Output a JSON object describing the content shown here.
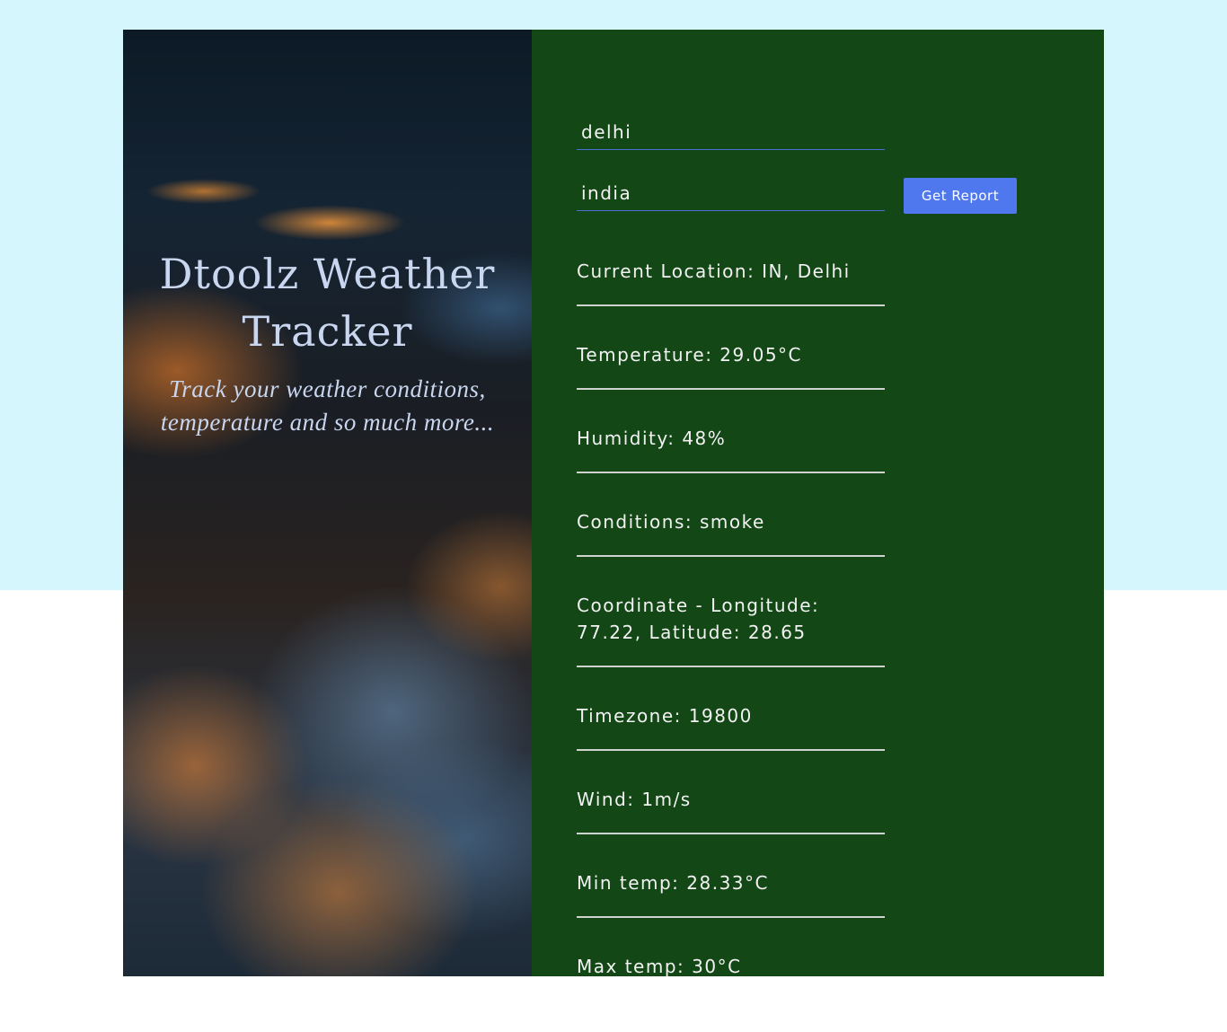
{
  "hero": {
    "title": "Dtoolz Weather Tracker",
    "subtitle": "Track your weather conditions, temperature and so much more..."
  },
  "form": {
    "city_value": "delhi",
    "country_value": "india",
    "button_label": "Get Report"
  },
  "report": {
    "location": "Current Location: IN, Delhi",
    "temperature": "Temperature: 29.05°C",
    "humidity": "Humidity: 48%",
    "conditions": "Conditions: smoke",
    "coordinates": "Coordinate - Longitude: 77.22, Latitude: 28.65",
    "timezone": "Timezone: 19800",
    "wind": "Wind: 1m/s",
    "min_temp": "Min temp: 28.33°C",
    "max_temp": "Max temp: 30°C"
  },
  "colors": {
    "page_background": "#d6f6fd",
    "panel_background": "#134716",
    "button_background": "#5078ee",
    "input_underline": "#4b6ed6",
    "text": "#f3f3f3"
  }
}
